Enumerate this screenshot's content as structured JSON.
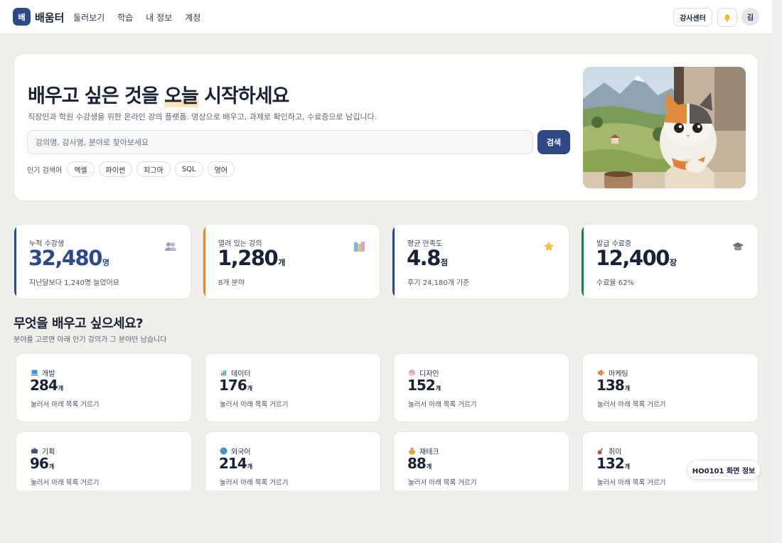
{
  "header": {
    "logo_glyph": "배",
    "brand": "배움터",
    "nav": [
      "둘러보기",
      "학습",
      "내 정보",
      "계정"
    ],
    "instructor_label": "강사센터",
    "avatar_initial": "김"
  },
  "hero": {
    "title_before": "배우고 싶은 것을 ",
    "title_highlight": "오늘",
    "title_after": " 시작하세요",
    "subtitle": "직장인과 학원 수강생을 위한 온라인 강의 플랫폼. 영상으로 배우고, 과제로 확인하고, 수료증으로 남깁니다.",
    "search_placeholder": "강의명, 강사명, 분야로 찾아보세요",
    "search_button": "검색",
    "popular_label": "인기 검색어",
    "popular_terms": [
      "엑셀",
      "파이썬",
      "피그마",
      "SQL",
      "영어"
    ]
  },
  "stats": [
    {
      "label": "누적 수강생",
      "value": "32,480",
      "unit": "명",
      "note": "지난달보다 1,240명 늘었어요",
      "accent": "#2d4a87",
      "icon": "users-icon"
    },
    {
      "label": "열려 있는 강의",
      "value": "1,280",
      "unit": "개",
      "note": "8개 분야",
      "accent": "#e8823a",
      "icon": "books-icon"
    },
    {
      "label": "평균 만족도",
      "value": "4.8",
      "unit": "점",
      "note": "후기 24,180개 기준",
      "accent": "#2d4a87",
      "icon": "star-icon"
    },
    {
      "label": "발급 수료증",
      "value": "12,400",
      "unit": "장",
      "note": "수료율 62%",
      "accent": "#1f7a4d",
      "icon": "graduation-cap-icon"
    }
  ],
  "categories_section": {
    "title": "무엇을 배우고 싶으세요?",
    "subtitle": "분야를 고르면 아래 인기 강의가 그 분야만 남습니다"
  },
  "categories": [
    {
      "name": "개발",
      "count": "284",
      "unit": "개",
      "hint": "눌러서 아래 목록 거르기",
      "icon": "laptop-icon"
    },
    {
      "name": "데이터",
      "count": "176",
      "unit": "개",
      "hint": "눌러서 아래 목록 거르기",
      "icon": "chart-icon"
    },
    {
      "name": "디자인",
      "count": "152",
      "unit": "개",
      "hint": "눌러서 아래 목록 거르기",
      "icon": "palette-icon"
    },
    {
      "name": "마케팅",
      "count": "138",
      "unit": "개",
      "hint": "눌러서 아래 목록 거르기",
      "icon": "megaphone-icon"
    },
    {
      "name": "기획",
      "count": "96",
      "unit": "개",
      "hint": "눌러서 아래 목록 거르기",
      "icon": "clipboard-icon"
    },
    {
      "name": "외국어",
      "count": "214",
      "unit": "개",
      "hint": "눌러서 아래 목록 거르기",
      "icon": "globe-icon"
    },
    {
      "name": "재테크",
      "count": "88",
      "unit": "개",
      "hint": "눌러서 아래 목록 거르기",
      "icon": "money-bag-icon"
    },
    {
      "name": "취미",
      "count": "132",
      "unit": "개",
      "hint": "눌러서 아래 목록 거르기",
      "icon": "guitar-icon"
    }
  ],
  "screen_info_label": "HO0101 화면 정보"
}
